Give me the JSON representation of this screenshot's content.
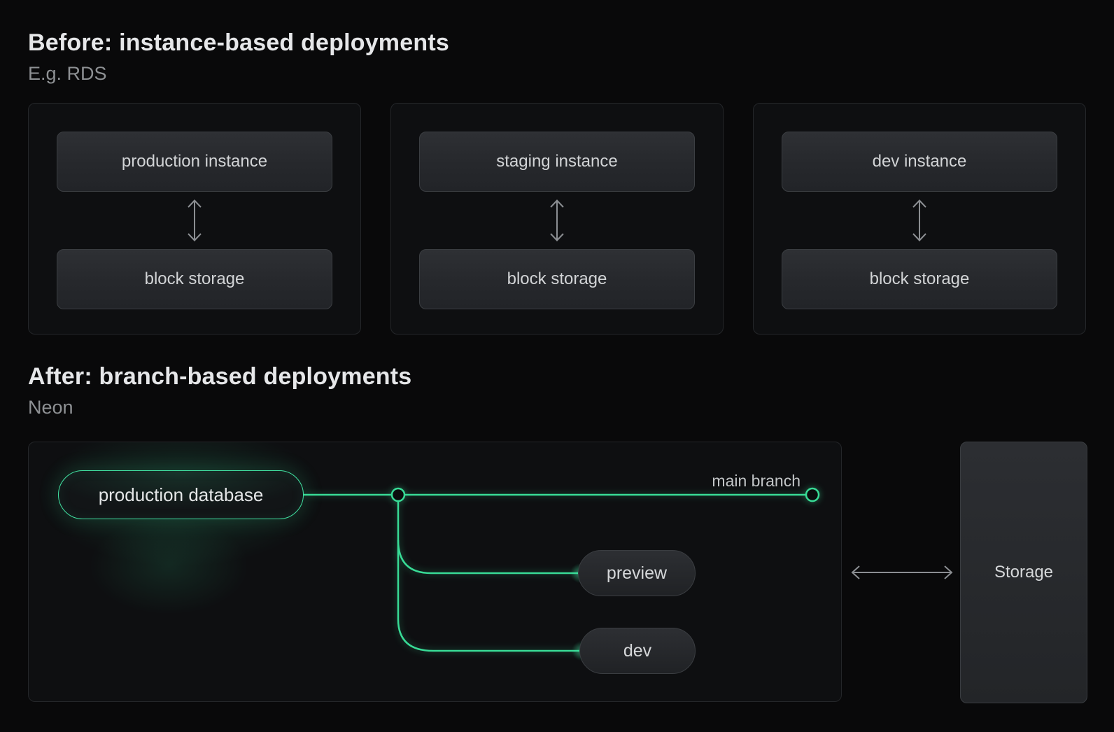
{
  "colors": {
    "background": "#09090A",
    "panel_background": "#0E0F11",
    "panel_border": "#242629",
    "node_border": "#3B3E42",
    "accent_green": "#38DB96",
    "arrow_gray": "#8B8E92",
    "text_primary": "#E6E7E9",
    "text_secondary": "#8E9194",
    "node_text": "#D2D4D6"
  },
  "before_section": {
    "title": "Before: instance-based deployments",
    "subtitle": "E.g. RDS",
    "panels": [
      {
        "instance_label": "production instance",
        "storage_label": "block storage"
      },
      {
        "instance_label": "staging instance",
        "storage_label": "block storage"
      },
      {
        "instance_label": "dev instance",
        "storage_label": "block storage"
      }
    ]
  },
  "after_section": {
    "title": "After: branch-based deployments",
    "subtitle": "Neon",
    "production_node_label": "production database",
    "main_branch_label": "main branch",
    "branch_nodes": [
      {
        "label": "preview"
      },
      {
        "label": "dev"
      }
    ],
    "storage_label": "Storage"
  }
}
